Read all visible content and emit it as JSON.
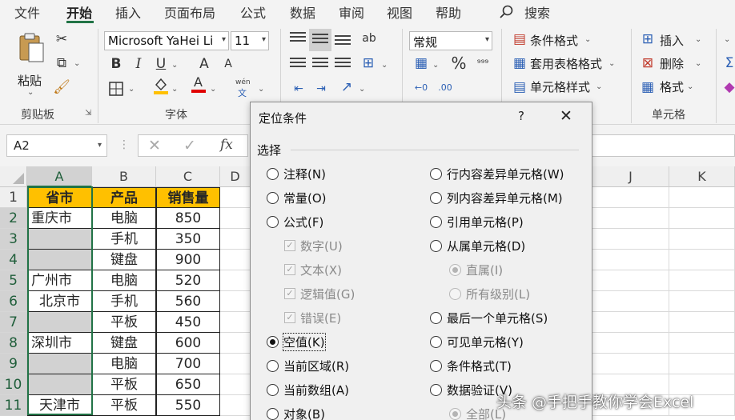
{
  "menu": {
    "tabs": [
      "文件",
      "开始",
      "插入",
      "页面布局",
      "公式",
      "数据",
      "审阅",
      "视图",
      "帮助"
    ],
    "active": "开始",
    "search": "搜索"
  },
  "ribbon": {
    "clipboard": {
      "paste": "粘贴",
      "group": "剪贴板"
    },
    "font": {
      "name": "Microsoft YaHei Li",
      "size": "11",
      "bold": "B",
      "italic": "I",
      "underline": "U",
      "grow": "A",
      "shrink": "A",
      "wen": "wén",
      "wen_char": "文",
      "group": "字体"
    },
    "alignment": {
      "wrap": "ab"
    },
    "number": {
      "format": "常规",
      "percent": "%"
    },
    "styles": {
      "conditional": "条件格式",
      "table": "套用表格格式",
      "cell": "单元格样式"
    },
    "cells": {
      "insert": "插入",
      "delete": "删除",
      "format": "格式",
      "group": "单元格"
    }
  },
  "formula_bar": {
    "name_box": "A2",
    "fx": "fx"
  },
  "sheet": {
    "columns": [
      "A",
      "B",
      "C",
      "D",
      "J",
      "K"
    ],
    "rows": [
      "1",
      "2",
      "3",
      "4",
      "5",
      "6",
      "7",
      "8",
      "9",
      "10",
      "11"
    ],
    "headers": [
      "省市",
      "产品",
      "销售量"
    ],
    "data": [
      [
        "重庆市",
        "电脑",
        "850"
      ],
      [
        "",
        "手机",
        "350"
      ],
      [
        "",
        "键盘",
        "900"
      ],
      [
        "广州市",
        "电脑",
        "520"
      ],
      [
        "北京市",
        "手机",
        "560"
      ],
      [
        "",
        "平板",
        "450"
      ],
      [
        "深圳市",
        "键盘",
        "600"
      ],
      [
        "",
        "电脑",
        "700"
      ],
      [
        "",
        "平板",
        "650"
      ],
      [
        "天津市",
        "平板",
        "550"
      ]
    ]
  },
  "dialog": {
    "title": "定位条件",
    "help": "?",
    "section": "选择",
    "left_options": [
      {
        "label": "注释(N)",
        "state": "normal"
      },
      {
        "label": "常量(O)",
        "state": "normal"
      },
      {
        "label": "公式(F)",
        "state": "normal"
      },
      {
        "label": "数字(U)",
        "state": "disabled-check"
      },
      {
        "label": "文本(X)",
        "state": "disabled-check"
      },
      {
        "label": "逻辑值(G)",
        "state": "disabled-check"
      },
      {
        "label": "错误(E)",
        "state": "disabled-check"
      },
      {
        "label": "空值(K)",
        "state": "checked"
      },
      {
        "label": "当前区域(R)",
        "state": "normal"
      },
      {
        "label": "当前数组(A)",
        "state": "normal"
      },
      {
        "label": "对象(B)",
        "state": "normal"
      }
    ],
    "right_options": [
      {
        "label": "行内容差异单元格(W)",
        "state": "normal"
      },
      {
        "label": "列内容差异单元格(M)",
        "state": "normal"
      },
      {
        "label": "引用单元格(P)",
        "state": "normal"
      },
      {
        "label": "从属单元格(D)",
        "state": "normal"
      },
      {
        "label": "直属(I)",
        "state": "disabled-checked"
      },
      {
        "label": "所有级别(L)",
        "state": "disabled"
      },
      {
        "label": "最后一个单元格(S)",
        "state": "normal"
      },
      {
        "label": "可见单元格(Y)",
        "state": "normal"
      },
      {
        "label": "条件格式(T)",
        "state": "normal"
      },
      {
        "label": "数据验证(V)",
        "state": "normal"
      },
      {
        "label": "全部(L)",
        "state": "disabled-checked"
      }
    ]
  },
  "watermark": "头条 @手把手教你学会Excel"
}
